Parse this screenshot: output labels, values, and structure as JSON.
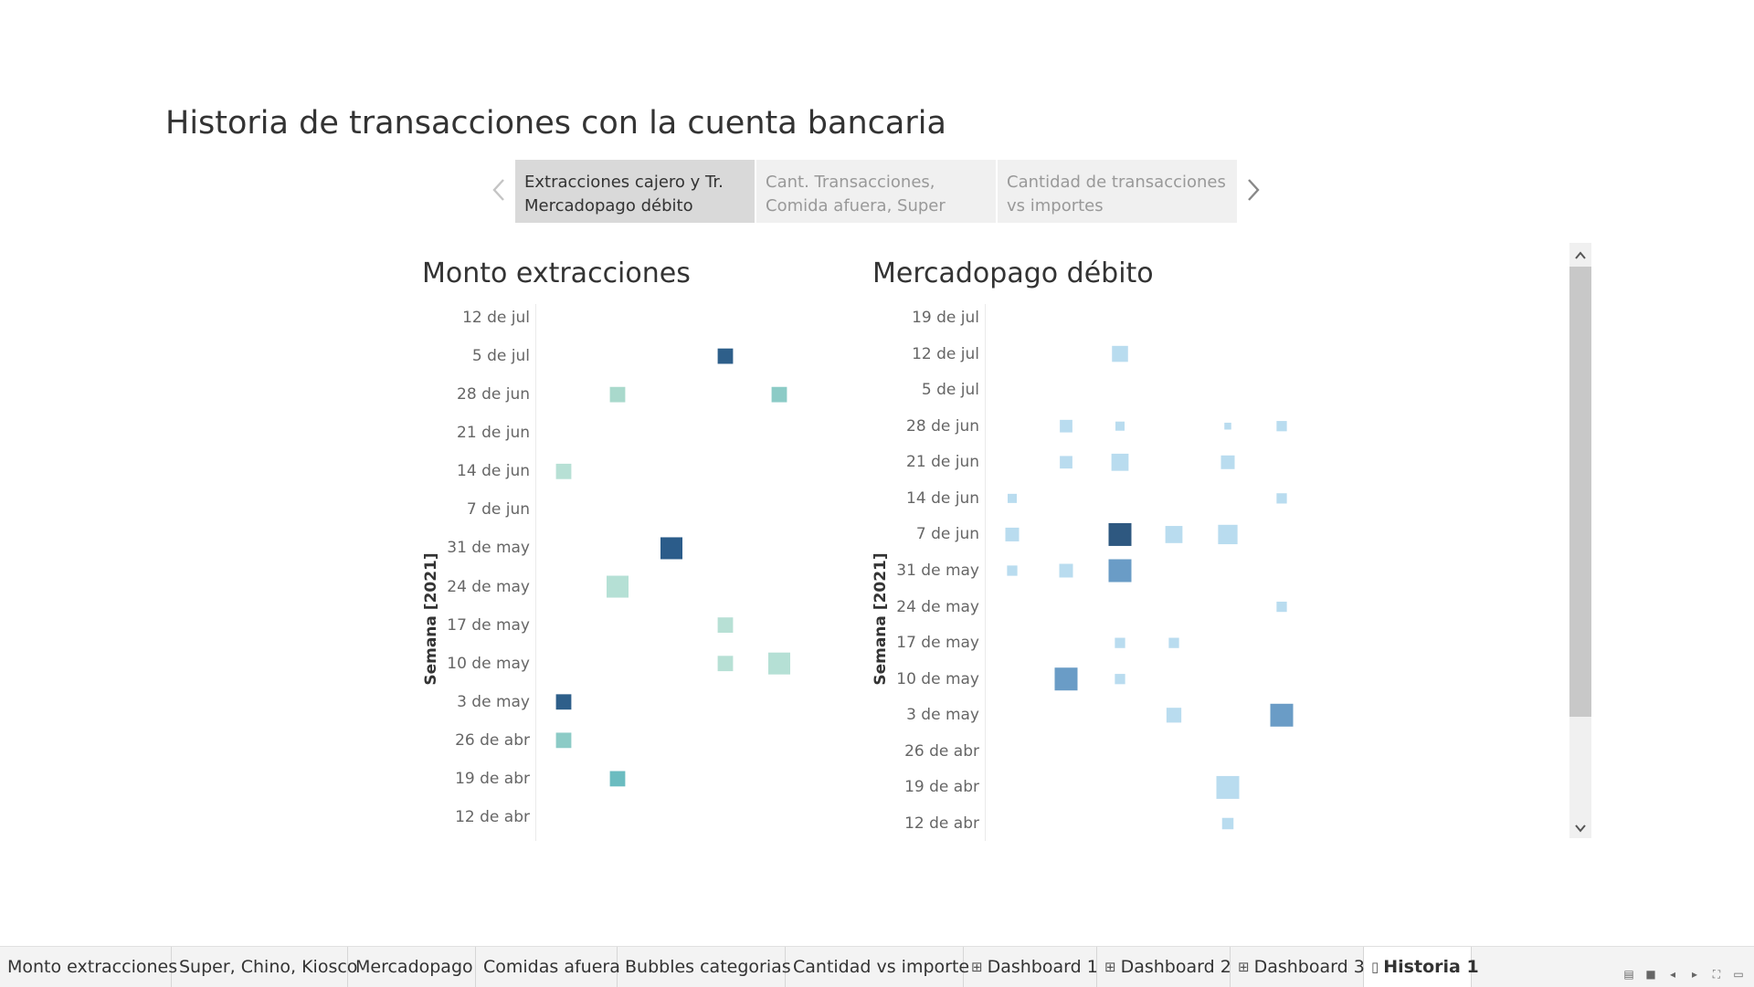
{
  "story": {
    "title": "Historia de transacciones con la cuenta bancaria",
    "points": [
      {
        "line1": "Extracciones cajero y Tr.",
        "line2": "Mercadopago débito",
        "active": true
      },
      {
        "line1": "Cant. Transacciones,",
        "line2": "Comida afuera, Super",
        "active": false
      },
      {
        "line1": "Cantidad de transacciones",
        "line2": "vs importes",
        "active": false
      }
    ],
    "prev_icon": "chevron-left-icon",
    "next_icon": "chevron-right-icon"
  },
  "chart_data": [
    {
      "type": "heatmap",
      "title": "Monto extracciones",
      "ylabel": "Semana [2021]",
      "categories": [
        "12 de jul",
        "5 de jul",
        "28 de jun",
        "21 de jun",
        "14 de jun",
        "7 de jun",
        "31 de may",
        "24 de may",
        "17 de may",
        "10 de may",
        "3 de may",
        "26 de abr",
        "19 de abr",
        "12 de abr"
      ],
      "columns": 5,
      "points": [
        {
          "week": "5 de jul",
          "col": 4,
          "size": 0.7,
          "color": "#2e5f8a"
        },
        {
          "week": "28 de jun",
          "col": 2,
          "size": 0.7,
          "color": "#a9d9cc"
        },
        {
          "week": "28 de jun",
          "col": 5,
          "size": 0.7,
          "color": "#8ccbc6"
        },
        {
          "week": "14 de jun",
          "col": 1,
          "size": 0.7,
          "color": "#b7e0d5"
        },
        {
          "week": "31 de may",
          "col": 3,
          "size": 1.0,
          "color": "#2b5c8a"
        },
        {
          "week": "24 de may",
          "col": 2,
          "size": 1.0,
          "color": "#b5e0d5"
        },
        {
          "week": "17 de may",
          "col": 4,
          "size": 0.7,
          "color": "#b7e0d5"
        },
        {
          "week": "10 de may",
          "col": 4,
          "size": 0.7,
          "color": "#b7e0d5"
        },
        {
          "week": "10 de may",
          "col": 5,
          "size": 1.0,
          "color": "#b5e0d5"
        },
        {
          "week": "3 de may",
          "col": 1,
          "size": 0.7,
          "color": "#2e5f8a"
        },
        {
          "week": "26 de abr",
          "col": 1,
          "size": 0.7,
          "color": "#8ccbc6"
        },
        {
          "week": "19 de abr",
          "col": 2,
          "size": 0.7,
          "color": "#6bbcc0"
        }
      ]
    },
    {
      "type": "heatmap",
      "title": "Mercadopago débito",
      "ylabel": "Semana [2021]",
      "categories": [
        "19 de jul",
        "12 de jul",
        "5 de jul",
        "28 de jun",
        "21 de jun",
        "14 de jun",
        "7 de jun",
        "31 de may",
        "24 de may",
        "17 de may",
        "10 de may",
        "3 de may",
        "26 de abr",
        "19 de abr",
        "12 de abr"
      ],
      "columns": 6,
      "points": [
        {
          "week": "12 de jul",
          "col": 3,
          "size": 0.7,
          "color": "#b9dcef"
        },
        {
          "week": "28 de jun",
          "col": 2,
          "size": 0.55,
          "color": "#b9dcef"
        },
        {
          "week": "28 de jun",
          "col": 3,
          "size": 0.4,
          "color": "#b9dcef"
        },
        {
          "week": "28 de jun",
          "col": 5,
          "size": 0.3,
          "color": "#b9dcef"
        },
        {
          "week": "28 de jun",
          "col": 6,
          "size": 0.45,
          "color": "#b9dcef"
        },
        {
          "week": "21 de jun",
          "col": 2,
          "size": 0.55,
          "color": "#b9dcef"
        },
        {
          "week": "21 de jun",
          "col": 3,
          "size": 0.75,
          "color": "#b9dcef"
        },
        {
          "week": "21 de jun",
          "col": 5,
          "size": 0.6,
          "color": "#b9dcef"
        },
        {
          "week": "14 de jun",
          "col": 1,
          "size": 0.4,
          "color": "#b9dcef"
        },
        {
          "week": "14 de jun",
          "col": 6,
          "size": 0.45,
          "color": "#b9dcef"
        },
        {
          "week": "7 de jun",
          "col": 1,
          "size": 0.6,
          "color": "#b9dcef"
        },
        {
          "week": "7 de jun",
          "col": 3,
          "size": 1.0,
          "color": "#2e5880"
        },
        {
          "week": "7 de jun",
          "col": 4,
          "size": 0.75,
          "color": "#b9dcef"
        },
        {
          "week": "7 de jun",
          "col": 5,
          "size": 0.85,
          "color": "#b9dcef"
        },
        {
          "week": "31 de may",
          "col": 1,
          "size": 0.45,
          "color": "#b9dcef"
        },
        {
          "week": "31 de may",
          "col": 2,
          "size": 0.6,
          "color": "#b9dcef"
        },
        {
          "week": "31 de may",
          "col": 3,
          "size": 1.0,
          "color": "#6a9cc6"
        },
        {
          "week": "24 de may",
          "col": 6,
          "size": 0.45,
          "color": "#b9dcef"
        },
        {
          "week": "17 de may",
          "col": 3,
          "size": 0.45,
          "color": "#b9dcef"
        },
        {
          "week": "17 de may",
          "col": 4,
          "size": 0.45,
          "color": "#b9dcef"
        },
        {
          "week": "10 de may",
          "col": 2,
          "size": 1.0,
          "color": "#6a9cc6"
        },
        {
          "week": "10 de may",
          "col": 3,
          "size": 0.45,
          "color": "#b9dcef"
        },
        {
          "week": "3 de may",
          "col": 4,
          "size": 0.65,
          "color": "#b9dcef"
        },
        {
          "week": "3 de may",
          "col": 6,
          "size": 1.0,
          "color": "#6a9cc6"
        },
        {
          "week": "19 de abr",
          "col": 5,
          "size": 1.0,
          "color": "#b9dcef"
        },
        {
          "week": "12 de abr",
          "col": 5,
          "size": 0.5,
          "color": "#b9dcef"
        }
      ]
    }
  ],
  "tabs": [
    {
      "label": "Monto extracciones",
      "icon": "",
      "active": false
    },
    {
      "label": "Super, Chino, Kiosco",
      "icon": "",
      "active": false
    },
    {
      "label": "Mercadopago",
      "icon": "",
      "active": false
    },
    {
      "label": "Comidas afuera",
      "icon": "",
      "active": false
    },
    {
      "label": "Bubbles categorias",
      "icon": "",
      "active": false
    },
    {
      "label": "Cantidad vs importe",
      "icon": "",
      "active": false
    },
    {
      "label": "Dashboard 1",
      "icon": "dashboard-icon",
      "active": false
    },
    {
      "label": "Dashboard 2",
      "icon": "dashboard-icon",
      "active": false
    },
    {
      "label": "Dashboard 3",
      "icon": "dashboard-icon",
      "active": false
    },
    {
      "label": "Historia 1",
      "icon": "story-icon",
      "active": true
    }
  ],
  "colors": {
    "accent_dark": "#2b5c8a",
    "story_active_bg": "#d9d9d9",
    "story_inactive_bg": "#f0f0f0"
  }
}
